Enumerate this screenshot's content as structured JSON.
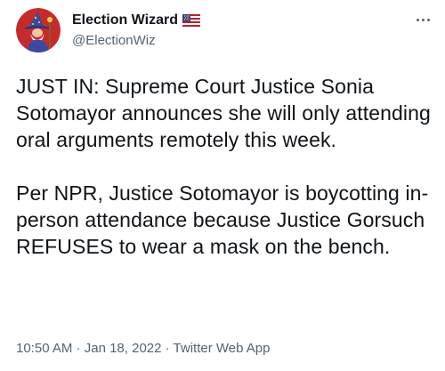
{
  "author": {
    "display_name": "Election Wizard",
    "handle": "@ElectionWiz",
    "avatar_icon": "wizard-avatar-icon",
    "flag_icon": "us-flag-icon"
  },
  "tweet": {
    "paragraph_1": "JUST IN: Supreme Court Justice Sonia Sotomayor announces she will only attending oral arguments remotely this week.",
    "paragraph_2": "Per NPR, Justice Sotomayor is boycotting in-person attendance because Justice Gorsuch REFUSES to wear a mask on the bench."
  },
  "meta": {
    "time": "10:50 AM",
    "separator": " · ",
    "date": "Jan 18, 2022",
    "source": "Twitter Web App"
  },
  "menu": {
    "more_icon": "more-dots-icon"
  },
  "colors": {
    "text": "#0f1419",
    "secondary": "#536471",
    "avatar_bg": "#c62b2b"
  }
}
